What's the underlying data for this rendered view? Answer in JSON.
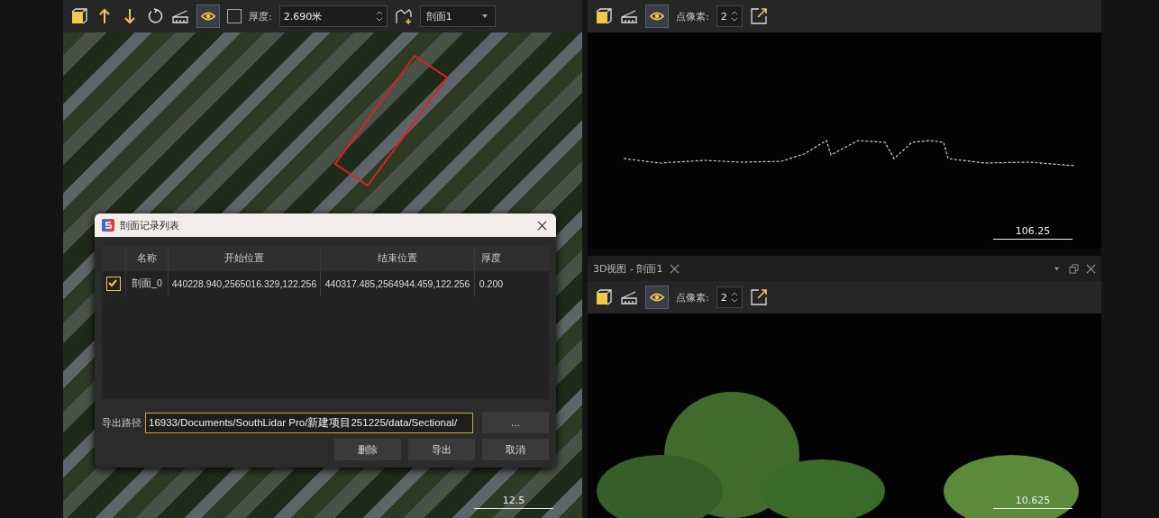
{
  "left_view": {
    "toolbar": {
      "view_toggle_on": true,
      "thickness_checked": false,
      "thickness_label": "厚度:",
      "thickness_value": "2.690米",
      "profile_select": "剖面1"
    },
    "scale_label": "12.5"
  },
  "dialog": {
    "title": "剖面记录列表",
    "columns": [
      "名称",
      "开始位置",
      "结束位置",
      "厚度"
    ],
    "rows": [
      {
        "checked": true,
        "name": "剖面_0",
        "start": "440228.940,2565016.329,122.256",
        "end": "440317.485,2564944.459,122.256",
        "thickness": "0.200"
      }
    ],
    "path_label": "导出路径",
    "path_value": "16933/Documents/SouthLidar Pro/新建项目251225/data/Sectional/",
    "browse_button": "...",
    "buttons": [
      "删除",
      "导出",
      "取消"
    ]
  },
  "top_right_view": {
    "toolbar": {
      "view_toggle_on": true,
      "point_size_label": "点像素:",
      "point_size_value": "2"
    },
    "scale_label": "106.25"
  },
  "bottom_right_view": {
    "tab_title": "3D视图 - 剖面1",
    "toolbar": {
      "view_toggle_on": true,
      "point_size_label": "点像素:",
      "point_size_value": "2"
    },
    "scale_label": "10.625"
  }
}
